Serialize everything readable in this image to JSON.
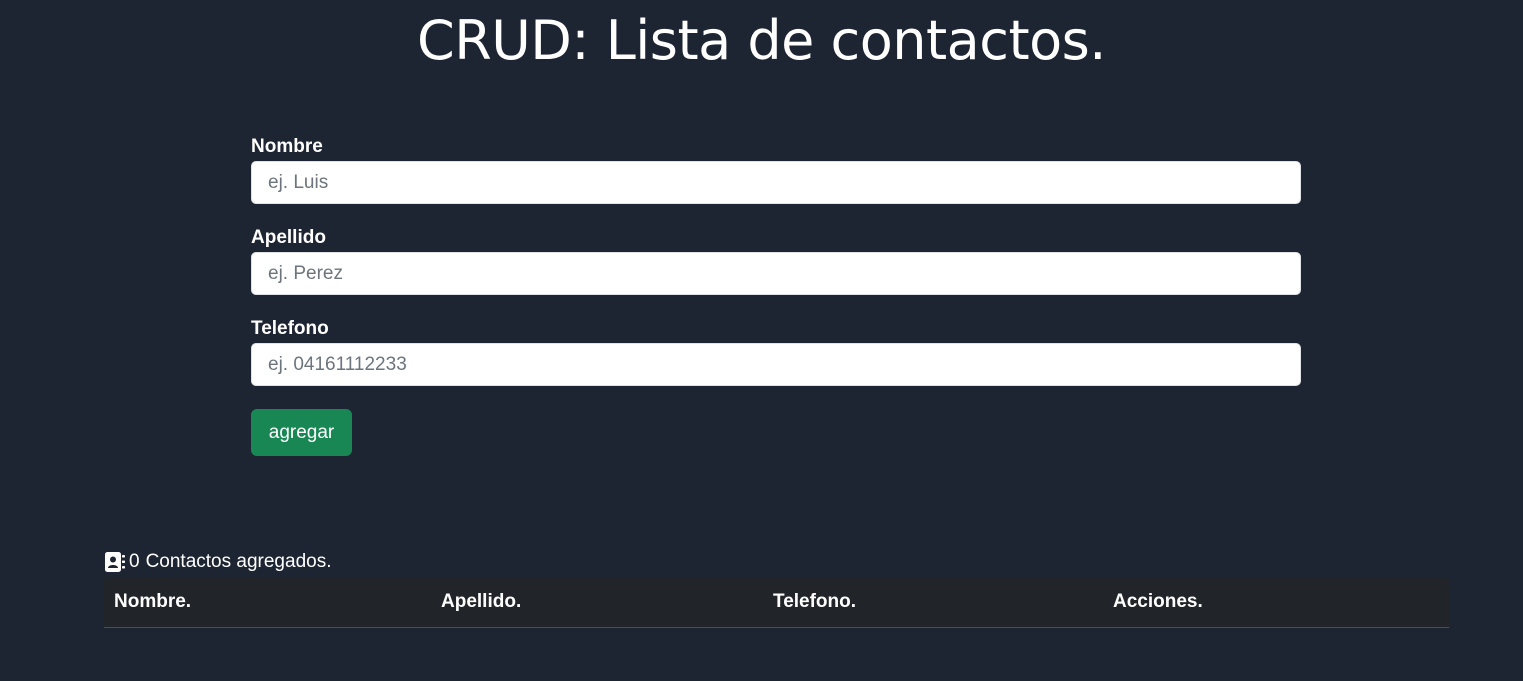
{
  "header": {
    "title": "CRUD: Lista de contactos."
  },
  "form": {
    "fields": [
      {
        "label": "Nombre",
        "placeholder": "ej. Luis",
        "value": ""
      },
      {
        "label": "Apellido",
        "placeholder": "ej. Perez",
        "value": ""
      },
      {
        "label": "Telefono",
        "placeholder": "ej. 04161112233",
        "value": ""
      }
    ],
    "submit_label": "agregar"
  },
  "contacts": {
    "icon": "address-book-icon",
    "count": "0",
    "count_label": "Contactos agregados.",
    "table": {
      "columns": [
        "Nombre.",
        "Apellido.",
        "Telefono.",
        "Acciones."
      ],
      "rows": []
    }
  },
  "colors": {
    "background": "#1e2532",
    "table_header": "#212529",
    "button": "#198754",
    "text": "#ffffff"
  }
}
